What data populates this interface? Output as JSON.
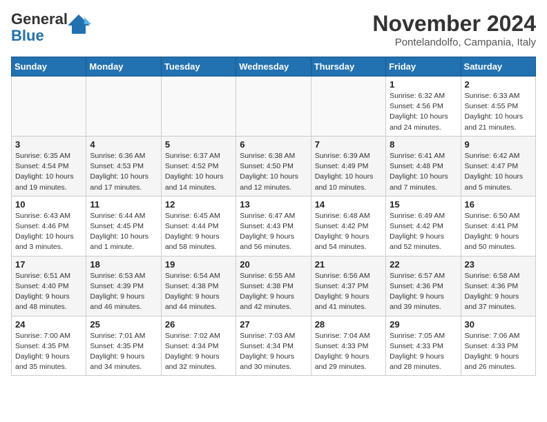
{
  "header": {
    "logo_line1": "General",
    "logo_line2": "Blue",
    "month_title": "November 2024",
    "location": "Pontelandolfo, Campania, Italy"
  },
  "days_of_week": [
    "Sunday",
    "Monday",
    "Tuesday",
    "Wednesday",
    "Thursday",
    "Friday",
    "Saturday"
  ],
  "weeks": [
    [
      {
        "day": "",
        "info": ""
      },
      {
        "day": "",
        "info": ""
      },
      {
        "day": "",
        "info": ""
      },
      {
        "day": "",
        "info": ""
      },
      {
        "day": "",
        "info": ""
      },
      {
        "day": "1",
        "info": "Sunrise: 6:32 AM\nSunset: 4:56 PM\nDaylight: 10 hours and 24 minutes."
      },
      {
        "day": "2",
        "info": "Sunrise: 6:33 AM\nSunset: 4:55 PM\nDaylight: 10 hours and 21 minutes."
      }
    ],
    [
      {
        "day": "3",
        "info": "Sunrise: 6:35 AM\nSunset: 4:54 PM\nDaylight: 10 hours and 19 minutes."
      },
      {
        "day": "4",
        "info": "Sunrise: 6:36 AM\nSunset: 4:53 PM\nDaylight: 10 hours and 17 minutes."
      },
      {
        "day": "5",
        "info": "Sunrise: 6:37 AM\nSunset: 4:52 PM\nDaylight: 10 hours and 14 minutes."
      },
      {
        "day": "6",
        "info": "Sunrise: 6:38 AM\nSunset: 4:50 PM\nDaylight: 10 hours and 12 minutes."
      },
      {
        "day": "7",
        "info": "Sunrise: 6:39 AM\nSunset: 4:49 PM\nDaylight: 10 hours and 10 minutes."
      },
      {
        "day": "8",
        "info": "Sunrise: 6:41 AM\nSunset: 4:48 PM\nDaylight: 10 hours and 7 minutes."
      },
      {
        "day": "9",
        "info": "Sunrise: 6:42 AM\nSunset: 4:47 PM\nDaylight: 10 hours and 5 minutes."
      }
    ],
    [
      {
        "day": "10",
        "info": "Sunrise: 6:43 AM\nSunset: 4:46 PM\nDaylight: 10 hours and 3 minutes."
      },
      {
        "day": "11",
        "info": "Sunrise: 6:44 AM\nSunset: 4:45 PM\nDaylight: 10 hours and 1 minute."
      },
      {
        "day": "12",
        "info": "Sunrise: 6:45 AM\nSunset: 4:44 PM\nDaylight: 9 hours and 58 minutes."
      },
      {
        "day": "13",
        "info": "Sunrise: 6:47 AM\nSunset: 4:43 PM\nDaylight: 9 hours and 56 minutes."
      },
      {
        "day": "14",
        "info": "Sunrise: 6:48 AM\nSunset: 4:42 PM\nDaylight: 9 hours and 54 minutes."
      },
      {
        "day": "15",
        "info": "Sunrise: 6:49 AM\nSunset: 4:42 PM\nDaylight: 9 hours and 52 minutes."
      },
      {
        "day": "16",
        "info": "Sunrise: 6:50 AM\nSunset: 4:41 PM\nDaylight: 9 hours and 50 minutes."
      }
    ],
    [
      {
        "day": "17",
        "info": "Sunrise: 6:51 AM\nSunset: 4:40 PM\nDaylight: 9 hours and 48 minutes."
      },
      {
        "day": "18",
        "info": "Sunrise: 6:53 AM\nSunset: 4:39 PM\nDaylight: 9 hours and 46 minutes."
      },
      {
        "day": "19",
        "info": "Sunrise: 6:54 AM\nSunset: 4:38 PM\nDaylight: 9 hours and 44 minutes."
      },
      {
        "day": "20",
        "info": "Sunrise: 6:55 AM\nSunset: 4:38 PM\nDaylight: 9 hours and 42 minutes."
      },
      {
        "day": "21",
        "info": "Sunrise: 6:56 AM\nSunset: 4:37 PM\nDaylight: 9 hours and 41 minutes."
      },
      {
        "day": "22",
        "info": "Sunrise: 6:57 AM\nSunset: 4:36 PM\nDaylight: 9 hours and 39 minutes."
      },
      {
        "day": "23",
        "info": "Sunrise: 6:58 AM\nSunset: 4:36 PM\nDaylight: 9 hours and 37 minutes."
      }
    ],
    [
      {
        "day": "24",
        "info": "Sunrise: 7:00 AM\nSunset: 4:35 PM\nDaylight: 9 hours and 35 minutes."
      },
      {
        "day": "25",
        "info": "Sunrise: 7:01 AM\nSunset: 4:35 PM\nDaylight: 9 hours and 34 minutes."
      },
      {
        "day": "26",
        "info": "Sunrise: 7:02 AM\nSunset: 4:34 PM\nDaylight: 9 hours and 32 minutes."
      },
      {
        "day": "27",
        "info": "Sunrise: 7:03 AM\nSunset: 4:34 PM\nDaylight: 9 hours and 30 minutes."
      },
      {
        "day": "28",
        "info": "Sunrise: 7:04 AM\nSunset: 4:33 PM\nDaylight: 9 hours and 29 minutes."
      },
      {
        "day": "29",
        "info": "Sunrise: 7:05 AM\nSunset: 4:33 PM\nDaylight: 9 hours and 28 minutes."
      },
      {
        "day": "30",
        "info": "Sunrise: 7:06 AM\nSunset: 4:33 PM\nDaylight: 9 hours and 26 minutes."
      }
    ]
  ]
}
